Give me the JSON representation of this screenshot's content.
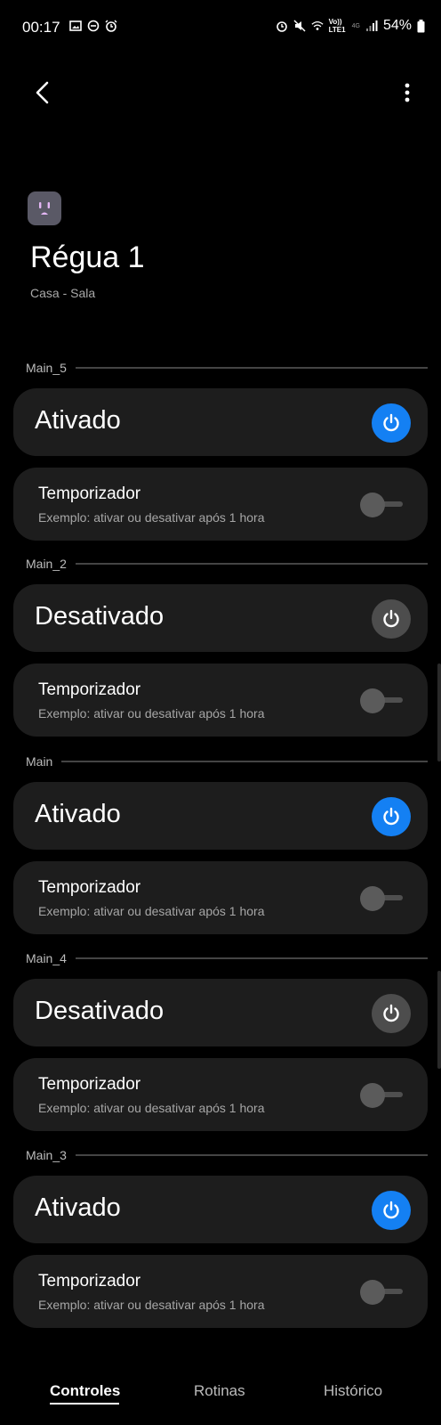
{
  "status_bar": {
    "time": "00:17",
    "battery": "54%",
    "network": "Vo)) LTE1",
    "gen": "4G"
  },
  "topbar": {
    "back_icon": "chevron-left-icon",
    "more_icon": "more-vertical-icon"
  },
  "device": {
    "icon": "power-outlet-icon",
    "name": "Régua 1",
    "location": "Casa - Sala"
  },
  "colors": {
    "accent": "#1480f3",
    "card_bg": "#1d1d1d",
    "off_button": "#4d4d4d"
  },
  "sections": [
    {
      "name": "Main_5",
      "state": "Ativado",
      "on": true,
      "timer_title": "Temporizador",
      "timer_sub": "Exemplo: ativar ou desativar após 1 hora",
      "timer_on": false
    },
    {
      "name": "Main_2",
      "state": "Desativado",
      "on": false,
      "timer_title": "Temporizador",
      "timer_sub": "Exemplo: ativar ou desativar após 1 hora",
      "timer_on": false
    },
    {
      "name": "Main",
      "state": "Ativado",
      "on": true,
      "timer_title": "Temporizador",
      "timer_sub": "Exemplo: ativar ou desativar após 1 hora",
      "timer_on": false
    },
    {
      "name": "Main_4",
      "state": "Desativado",
      "on": false,
      "timer_title": "Temporizador",
      "timer_sub": "Exemplo: ativar ou desativar após 1 hora",
      "timer_on": false
    },
    {
      "name": "Main_3",
      "state": "Ativado",
      "on": true,
      "timer_title": "Temporizador",
      "timer_sub": "Exemplo: ativar ou desativar após 1 hora",
      "timer_on": false
    }
  ],
  "bottom_nav": {
    "tabs": [
      {
        "label": "Controles",
        "active": true
      },
      {
        "label": "Rotinas",
        "active": false
      },
      {
        "label": "Histórico",
        "active": false
      }
    ]
  }
}
